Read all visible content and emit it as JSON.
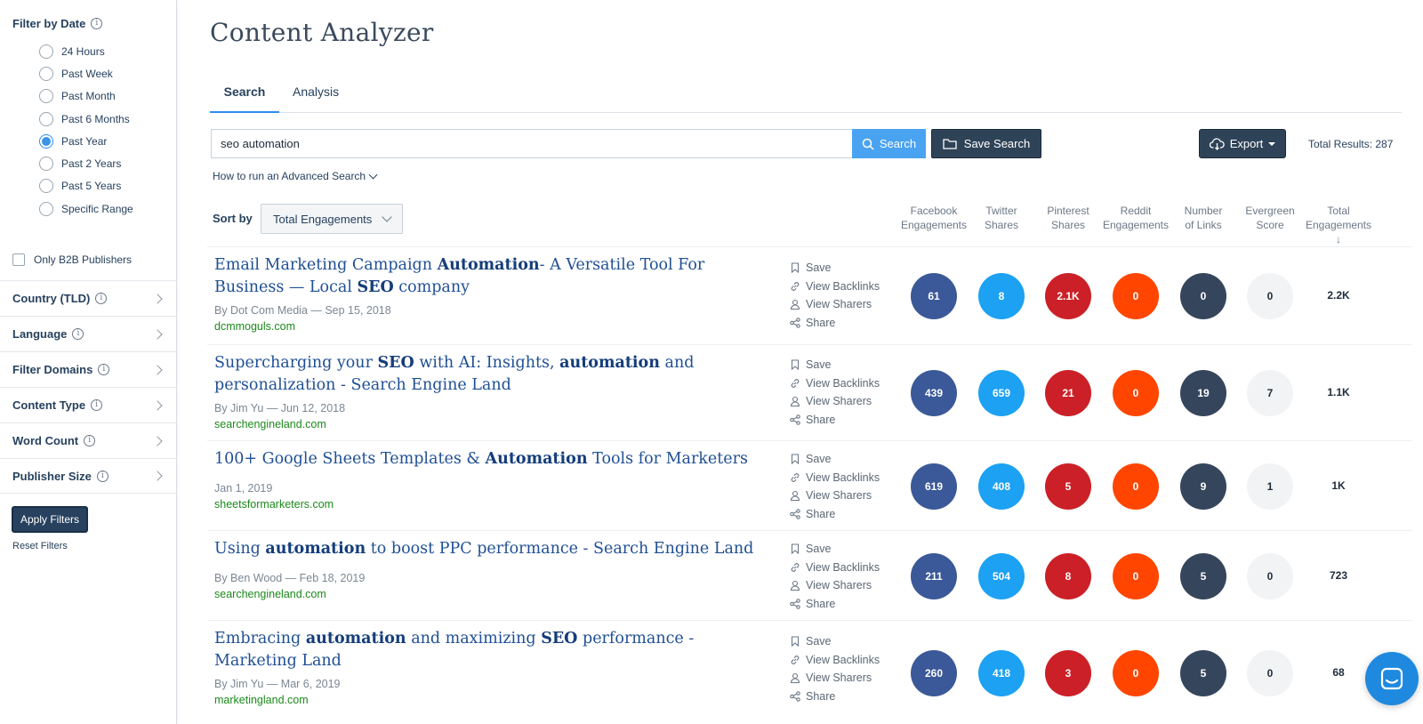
{
  "sidebar": {
    "date_filter_title": "Filter by Date",
    "date_options": [
      {
        "label": "24 Hours",
        "checked": false
      },
      {
        "label": "Past Week",
        "checked": false
      },
      {
        "label": "Past Month",
        "checked": false
      },
      {
        "label": "Past 6 Months",
        "checked": false
      },
      {
        "label": "Past Year",
        "checked": true
      },
      {
        "label": "Past 2 Years",
        "checked": false
      },
      {
        "label": "Past 5 Years",
        "checked": false
      },
      {
        "label": "Specific Range",
        "checked": false
      }
    ],
    "b2b_label": "Only B2B Publishers",
    "filters": [
      {
        "label": "Country (TLD)"
      },
      {
        "label": "Language"
      },
      {
        "label": "Filter Domains"
      },
      {
        "label": "Content Type"
      },
      {
        "label": "Word Count"
      },
      {
        "label": "Publisher Size"
      }
    ],
    "apply_label": "Apply Filters",
    "reset_label": "Reset Filters"
  },
  "header": {
    "title": "Content Analyzer",
    "tabs": [
      {
        "label": "Search"
      },
      {
        "label": "Analysis"
      }
    ]
  },
  "search": {
    "value": "seo automation",
    "button_label": "Search",
    "save_label": "Save Search",
    "export_label": "Export",
    "total_results": "Total Results: 287",
    "advanced_label": "How to run an Advanced Search"
  },
  "sort": {
    "label": "Sort by",
    "selected": "Total Engagements"
  },
  "columns": [
    {
      "line1": "Facebook",
      "line2": "Engagements"
    },
    {
      "line1": "Twitter",
      "line2": "Shares"
    },
    {
      "line1": "Pinterest",
      "line2": "Shares"
    },
    {
      "line1": "Reddit",
      "line2": "Engagements"
    },
    {
      "line1": "Number",
      "line2": "of Links"
    },
    {
      "line1": "Evergreen",
      "line2": "Score"
    },
    {
      "line1": "Total",
      "line2": "Engagements ↓"
    }
  ],
  "actions": {
    "save": "Save",
    "backlinks": "View Backlinks",
    "sharers": "View Sharers",
    "share": "Share"
  },
  "results": [
    {
      "title_html": "Email Marketing Campaign <b>Automation</b>- A Versatile Tool For Business — Local <b>SEO</b> company",
      "meta": "By Dot Com Media — Sep 15, 2018",
      "domain": "dcmmoguls.com",
      "facebook": "61",
      "twitter": "8",
      "pinterest": "2.1K",
      "reddit": "0",
      "links": "0",
      "evergreen": "0",
      "total": "2.2K"
    },
    {
      "title_html": "Supercharging your <b>SEO</b> with AI: Insights, <b>automation</b> and personalization - Search Engine Land",
      "meta": "By Jim Yu — Jun 12, 2018",
      "domain": "searchengineland.com",
      "facebook": "439",
      "twitter": "659",
      "pinterest": "21",
      "reddit": "0",
      "links": "19",
      "evergreen": "7",
      "total": "1.1K"
    },
    {
      "title_html": "100+ Google Sheets Templates &amp; <b>Automation</b> Tools for Marketers",
      "meta": "Jan 1, 2019",
      "domain": "sheetsformarketers.com",
      "facebook": "619",
      "twitter": "408",
      "pinterest": "5",
      "reddit": "0",
      "links": "9",
      "evergreen": "1",
      "total": "1K"
    },
    {
      "title_html": "Using <b>automation</b> to boost PPC performance - Search Engine Land",
      "meta": "By Ben Wood — Feb 18, 2019",
      "domain": "searchengineland.com",
      "facebook": "211",
      "twitter": "504",
      "pinterest": "8",
      "reddit": "0",
      "links": "5",
      "evergreen": "0",
      "total": "723"
    },
    {
      "title_html": "Embracing <b>automation</b> and maximizing <b>SEO</b> performance - Marketing Land",
      "meta": "By Jim Yu — Mar 6, 2019",
      "domain": "marketingland.com",
      "facebook": "260",
      "twitter": "418",
      "pinterest": "3",
      "reddit": "0",
      "links": "5",
      "evergreen": "0",
      "total": "68"
    }
  ],
  "colors": {
    "facebook": "#3b5998",
    "twitter": "#1da1f2",
    "pinterest": "#cb2027",
    "reddit": "#ff4500",
    "links": "#35465c",
    "evergreen": "#f2f3f4",
    "primary": "#27415e",
    "accent": "#2d8cf0",
    "domain_green": "#1b8a1b"
  }
}
